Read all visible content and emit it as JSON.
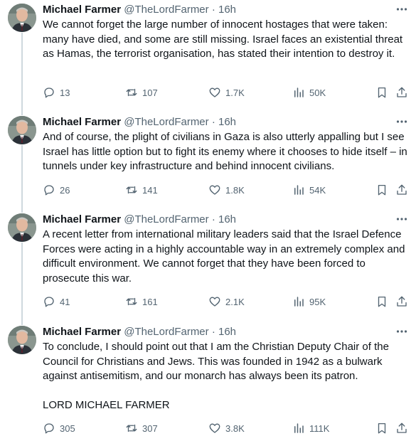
{
  "colors": {
    "text": "#0f1419",
    "muted": "#536471",
    "divider": "#eff3f4",
    "thread": "#cfd9de"
  },
  "tweets": [
    {
      "author": {
        "name": "Michael Farmer",
        "handle": "@TheLordFarmer",
        "sep": "·",
        "time": "16h"
      },
      "text": "We cannot forget the large number of innocent hostages that were taken: many have died, and some are still missing. Israel faces an existential threat as Hamas, the terrorist organisation, has stated their intention to destroy it.",
      "stats": {
        "replies": "13",
        "reposts": "107",
        "likes": "1.7K",
        "views": "50K"
      }
    },
    {
      "author": {
        "name": "Michael Farmer",
        "handle": "@TheLordFarmer",
        "sep": "·",
        "time": "16h"
      },
      "text": "And of course, the plight of civilians in Gaza is also utterly appalling but I see Israel has little option but to fight its enemy where it chooses to hide itself – in tunnels under key infrastructure and behind innocent civilians.",
      "stats": {
        "replies": "26",
        "reposts": "141",
        "likes": "1.8K",
        "views": "54K"
      }
    },
    {
      "author": {
        "name": "Michael Farmer",
        "handle": "@TheLordFarmer",
        "sep": "·",
        "time": "16h"
      },
      "text": "A recent letter from international military leaders said that the Israel Defence Forces were acting in a highly accountable way in an extremely complex and difficult environment. We cannot forget that they have been forced to prosecute this war.",
      "stats": {
        "replies": "41",
        "reposts": "161",
        "likes": "2.1K",
        "views": "95K"
      }
    },
    {
      "author": {
        "name": "Michael Farmer",
        "handle": "@TheLordFarmer",
        "sep": "·",
        "time": "16h"
      },
      "text": "To conclude, I should point out that I am the Christian Deputy Chair of the Council for Christians and Jews. This was founded in 1942 as a bulwark against antisemitism, and our monarch has always been its patron.\n\nLORD MICHAEL FARMER",
      "stats": {
        "replies": "305",
        "reposts": "307",
        "likes": "3.8K",
        "views": "111K"
      }
    }
  ]
}
